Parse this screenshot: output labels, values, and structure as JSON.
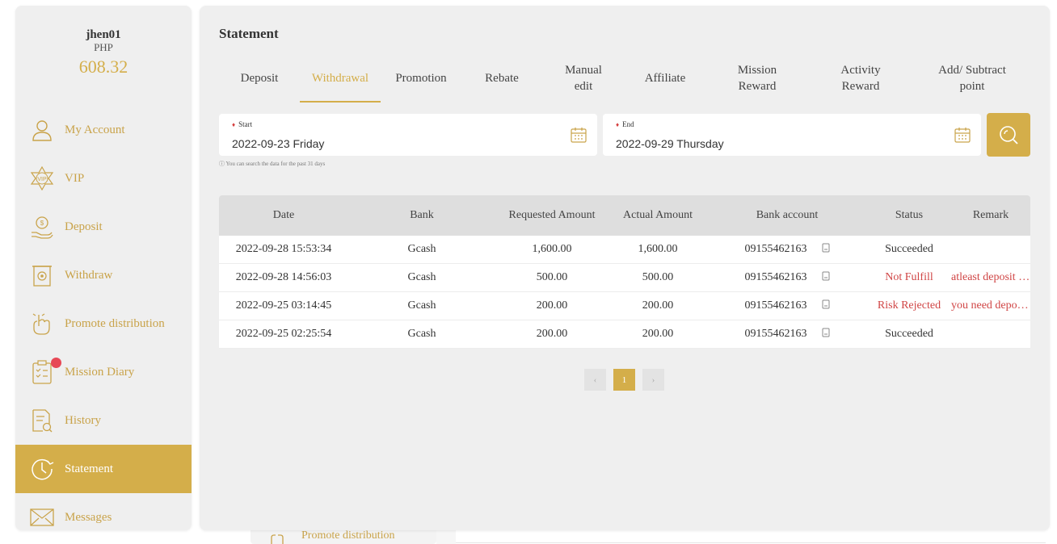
{
  "user": {
    "name": "jhen01",
    "currency": "PHP",
    "balance": "608.32"
  },
  "sidebar": {
    "items": [
      {
        "label": "My Account",
        "icon": "user-icon"
      },
      {
        "label": "VIP",
        "icon": "vip-badge-icon"
      },
      {
        "label": "Deposit",
        "icon": "deposit-hand-coin-icon"
      },
      {
        "label": "Withdraw",
        "icon": "withdraw-icon"
      },
      {
        "label": "Promote distribution",
        "icon": "promote-hand-icon"
      },
      {
        "label": "Mission Diary",
        "icon": "checklist-icon",
        "notification": true
      },
      {
        "label": "History",
        "icon": "history-document-icon"
      },
      {
        "label": "Statement",
        "icon": "clock-icon",
        "active": true
      },
      {
        "label": "Messages",
        "icon": "envelope-icon"
      }
    ]
  },
  "page": {
    "title": "Statement"
  },
  "tabs": [
    {
      "label": "Deposit"
    },
    {
      "label": "Withdrawal",
      "active": true
    },
    {
      "label": "Promotion"
    },
    {
      "label": "Rebate"
    },
    {
      "label": "Manual edit"
    },
    {
      "label": "Affiliate"
    },
    {
      "label": "Mission Reward"
    },
    {
      "label": "Activity Reward"
    },
    {
      "label": "Add/ Subtract point"
    }
  ],
  "filter": {
    "start_label": "Start",
    "start_value": "2022-09-23 Friday",
    "end_label": "End",
    "end_value": "2022-09-29 Thursday",
    "hint": "You can search the data for the past 31 days"
  },
  "table": {
    "headers": [
      "Date",
      "Bank",
      "Requested Amount",
      "Actual Amount",
      "Bank account",
      "Status",
      "Remark"
    ],
    "rows": [
      {
        "date": "2022-09-28 15:53:34",
        "bank": "Gcash",
        "requested": "1,600.00",
        "actual": "1,600.00",
        "account": "09155462163",
        "status": "Succeeded",
        "remark": ""
      },
      {
        "date": "2022-09-28 14:56:03",
        "bank": "Gcash",
        "requested": "500.00",
        "actual": "500.00",
        "account": "09155462163",
        "status": "Not Fulfill",
        "remark": "atleast deposit …"
      },
      {
        "date": "2022-09-25 03:14:45",
        "bank": "Gcash",
        "requested": "200.00",
        "actual": "200.00",
        "account": "09155462163",
        "status": "Risk Rejected",
        "remark": "you need depo…"
      },
      {
        "date": "2022-09-25 02:25:54",
        "bank": "Gcash",
        "requested": "200.00",
        "actual": "200.00",
        "account": "09155462163",
        "status": "Succeeded",
        "remark": ""
      }
    ]
  },
  "pagination": {
    "prev": "‹",
    "current": "1",
    "next": "›"
  },
  "background": {
    "peek_label": "Promote distribution"
  },
  "colors": {
    "accent": "#d4ae4a",
    "error": "#d04545",
    "panel": "#efefef"
  }
}
